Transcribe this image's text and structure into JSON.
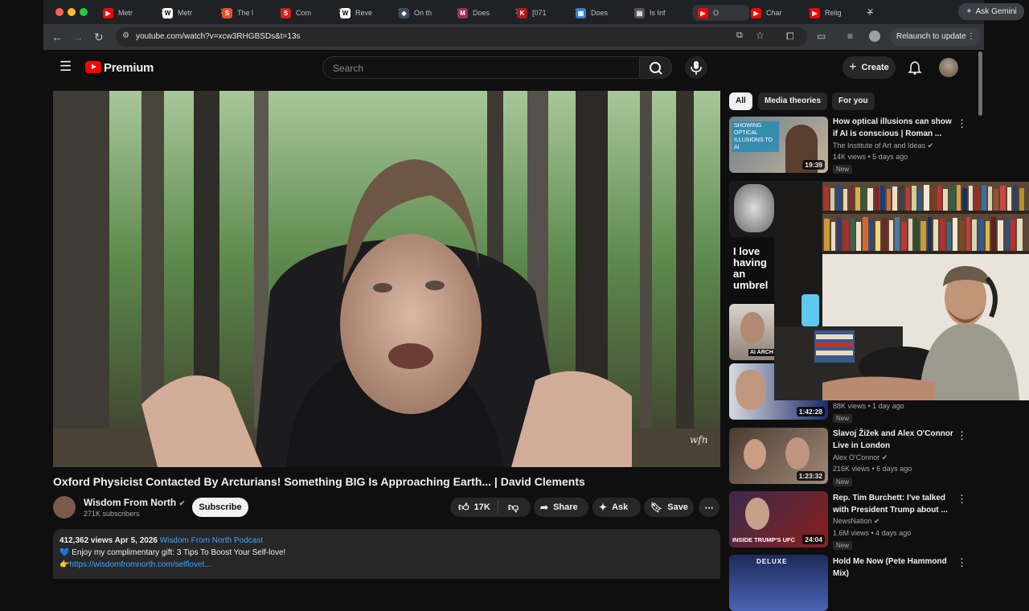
{
  "browser": {
    "tabs": [
      {
        "label": "Metr",
        "fav_color": "#ff0000",
        "fav_glyph": "▶"
      },
      {
        "label": "Metr",
        "fav_color": "#ffffff",
        "fav_glyph": "W"
      },
      {
        "label": "The l",
        "fav_color": "#e8502a",
        "fav_glyph": "S"
      },
      {
        "label": "Com",
        "fav_color": "#cc2222",
        "fav_glyph": "S"
      },
      {
        "label": "Reve",
        "fav_color": "#ffffff",
        "fav_glyph": "W"
      },
      {
        "label": "On th",
        "fav_color": "#3b4a6b",
        "fav_glyph": "◆"
      },
      {
        "label": "Does",
        "fav_color": "#a12b5c",
        "fav_glyph": "M"
      },
      {
        "label": "[071",
        "fav_color": "#b31b1b",
        "fav_glyph": "K"
      },
      {
        "label": "Does",
        "fav_color": "#2d7fd3",
        "fav_glyph": "▣"
      },
      {
        "label": "Is Inf",
        "fav_color": "#555555",
        "fav_glyph": "▤"
      },
      {
        "label": "O",
        "fav_color": "#ff0000",
        "fav_glyph": "▶"
      },
      {
        "label": "Char",
        "fav_color": "#ff0000",
        "fav_glyph": "▶"
      },
      {
        "label": "Relig",
        "fav_color": "#ff0000",
        "fav_glyph": "▶"
      }
    ],
    "ask_gemini": "Ask Gemini",
    "url": "youtube.com/watch?v=xcw3RHGBSDs&t=13s",
    "relaunch": "Relaunch to update"
  },
  "yt": {
    "logo_text": "Premium",
    "search_placeholder": "Search",
    "create_label": "Create"
  },
  "video": {
    "title": "Oxford Physicist Contacted By Arcturians! Something BIG Is Approaching Earth... | David Clements",
    "watermark": "wfn",
    "channel": "Wisdom From North",
    "subscribers": "271K subscribers",
    "subscribe_label": "Subscribe",
    "likes": "17K",
    "share_label": "Share",
    "ask_label": "Ask",
    "save_label": "Save",
    "description": {
      "stats": "412,362 views  Apr 5, 2026",
      "podcast_link": "Wisdom From North Podcast",
      "line2": "💙 Enjoy my complimentary gift: 3 Tips To Boost Your Self-love!",
      "line3_prefix": "👉",
      "line3_link": "https://wisdomfromnorth.com/selflovet..."
    }
  },
  "sidebar": {
    "chips": [
      "All",
      "Media theories",
      "For you"
    ],
    "items": [
      {
        "title": "How optical illusions can show if AI is conscious | Roman ...",
        "channel": "The Institute of Art and Ideas",
        "meta": "14K views • 5 days ago",
        "badge": "New",
        "duration": "19:39",
        "thumb_text": "SHOWING OPTICAL ILLUSIONS TO AI"
      },
      {
        "thumb_text": "I love having an umbrel"
      },
      {
        "thumb_text": "AI ARCH"
      },
      {
        "meta": "88K views • 1 day ago",
        "badge": "New",
        "duration": "1:42:28"
      },
      {
        "title": "Slavoj Žižek and Alex O'Connor Live in London",
        "channel": "Alex O'Connor",
        "meta": "216K views • 6 days ago",
        "badge": "New",
        "duration": "1:23:32"
      },
      {
        "title": "Rep. Tim Burchett: I've talked with President Trump about ...",
        "channel": "NewsNation",
        "meta": "1.6M views • 4 days ago",
        "badge": "New",
        "duration": "24:04",
        "thumb_text": "INSIDE TRUMP'S UFC"
      },
      {
        "title": "Hold Me Now (Pete Hammond Mix)",
        "thumb_text": "DELUXE"
      }
    ]
  },
  "colors": {
    "brand": "#ff0000",
    "link": "#3ea6ff",
    "bg": "#0f0f0f"
  }
}
